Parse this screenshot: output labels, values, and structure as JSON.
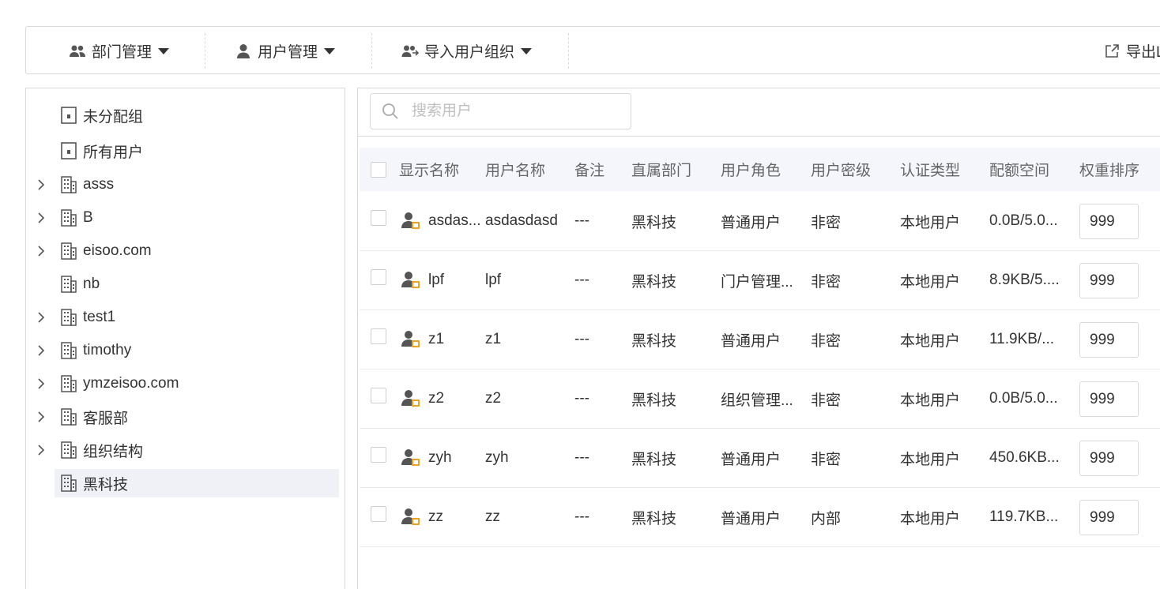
{
  "toolbar": {
    "dept_mgmt": "部门管理",
    "user_mgmt": "用户管理",
    "import_org": "导入用户组织",
    "export": "导出L"
  },
  "tree": {
    "nodes": [
      {
        "label": "未分配组",
        "icon": "unassigned-group-icon",
        "expandable": false
      },
      {
        "label": "所有用户",
        "icon": "all-users-icon",
        "expandable": false
      },
      {
        "label": "asss",
        "icon": "building-icon",
        "expandable": true
      },
      {
        "label": "B",
        "icon": "building-icon",
        "expandable": true
      },
      {
        "label": "eisoo.com",
        "icon": "building-icon",
        "expandable": true
      },
      {
        "label": "nb",
        "icon": "building-icon",
        "expandable": false
      },
      {
        "label": "test1",
        "icon": "building-icon",
        "expandable": true
      },
      {
        "label": "timothy",
        "icon": "building-icon",
        "expandable": true
      },
      {
        "label": "ymzeisoo.com",
        "icon": "building-icon",
        "expandable": true
      },
      {
        "label": "客服部",
        "icon": "building-icon",
        "expandable": true
      },
      {
        "label": "组织结构",
        "icon": "building-icon",
        "expandable": true
      },
      {
        "label": "黑科技",
        "icon": "building-icon",
        "expandable": false,
        "selected": true
      }
    ]
  },
  "search": {
    "placeholder": "搜索用户"
  },
  "table": {
    "headers": {
      "display_name": "显示名称",
      "user_name": "用户名称",
      "remark": "备注",
      "dept": "直属部门",
      "role": "用户角色",
      "secret": "用户密级",
      "auth": "认证类型",
      "quota": "配额空间",
      "weight": "权重排序"
    },
    "rows": [
      {
        "display": "asdas...",
        "user": "asdasdasd",
        "remark": "---",
        "dept": "黑科技",
        "role": "普通用户",
        "secret": "非密",
        "auth": "本地用户",
        "quota": "0.0B/5.0...",
        "weight": "999"
      },
      {
        "display": "lpf",
        "user": "lpf",
        "remark": "---",
        "dept": "黑科技",
        "role": "门户管理...",
        "secret": "非密",
        "auth": "本地用户",
        "quota": "8.9KB/5....",
        "weight": "999"
      },
      {
        "display": "z1",
        "user": "z1",
        "remark": "---",
        "dept": "黑科技",
        "role": "普通用户",
        "secret": "非密",
        "auth": "本地用户",
        "quota": "11.9KB/...",
        "weight": "999"
      },
      {
        "display": "z2",
        "user": "z2",
        "remark": "---",
        "dept": "黑科技",
        "role": "组织管理...",
        "secret": "非密",
        "auth": "本地用户",
        "quota": "0.0B/5.0...",
        "weight": "999"
      },
      {
        "display": "zyh",
        "user": "zyh",
        "remark": "---",
        "dept": "黑科技",
        "role": "普通用户",
        "secret": "非密",
        "auth": "本地用户",
        "quota": "450.6KB...",
        "weight": "999"
      },
      {
        "display": "zz",
        "user": "zz",
        "remark": "---",
        "dept": "黑科技",
        "role": "普通用户",
        "secret": "内部",
        "auth": "本地用户",
        "quota": "119.7KB...",
        "weight": "999"
      }
    ]
  },
  "colors": {
    "selected_bg": "#eff1f6",
    "header_bg": "#f4f6fb",
    "border": "#d9d9d9",
    "user_icon_badge": "#f0a020"
  }
}
